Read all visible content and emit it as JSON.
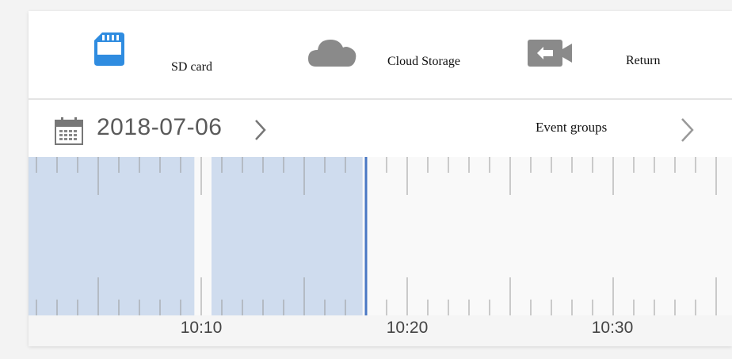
{
  "toolbar": {
    "sd_card": {
      "label": "SD card",
      "icon": "sd-card-icon"
    },
    "cloud": {
      "label": "Cloud Storage",
      "icon": "cloud-icon"
    },
    "return": {
      "label": "Return",
      "icon": "return-camera-icon"
    }
  },
  "date_bar": {
    "date": "2018-07-06",
    "date_arrow": "chevron-right-icon",
    "event_groups_label": "Event groups",
    "event_arrow": "chevron-right-icon"
  },
  "timeline": {
    "time_labels": [
      "10:10",
      "10:20",
      "10:30"
    ],
    "recorded_segments": [
      {
        "start": "10:01:00",
        "end": "10:09:40"
      },
      {
        "start": "10:10:30",
        "end": "10:17:50"
      }
    ],
    "playhead_time": "10:18:00",
    "colors": {
      "segment": "#cfdcee",
      "playhead": "#4a78c4",
      "sd_icon": "#2f8ce0",
      "grey_icon": "#8a8a8a"
    }
  }
}
